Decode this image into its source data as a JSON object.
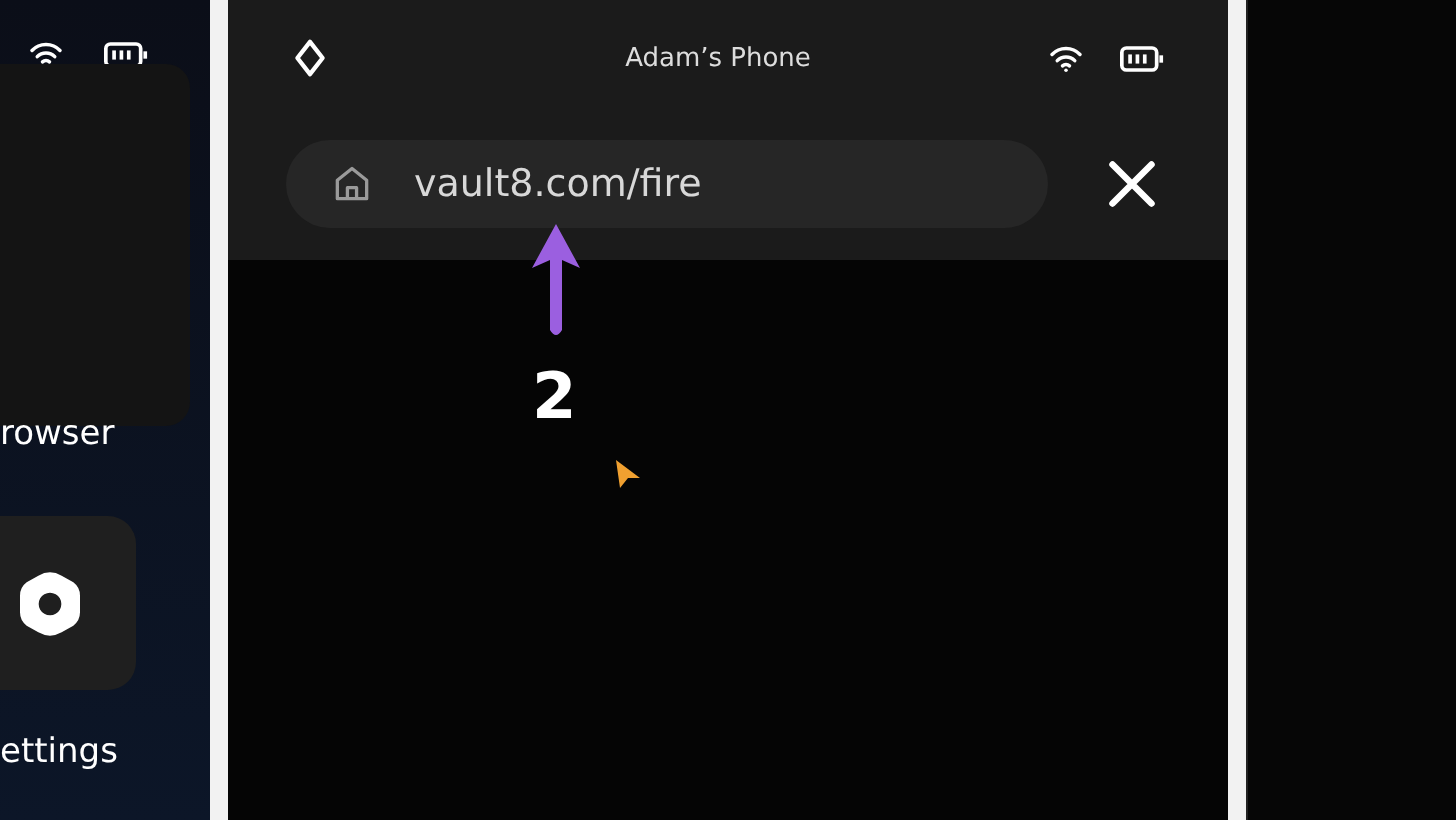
{
  "left_screen": {
    "apps": [
      {
        "label": "rowser"
      },
      {
        "label": "ettings"
      }
    ]
  },
  "phone_screen": {
    "title": "Adam’s Phone",
    "address_bar": {
      "value": "vault8.com/fire"
    }
  },
  "annotation": {
    "label": "2"
  }
}
